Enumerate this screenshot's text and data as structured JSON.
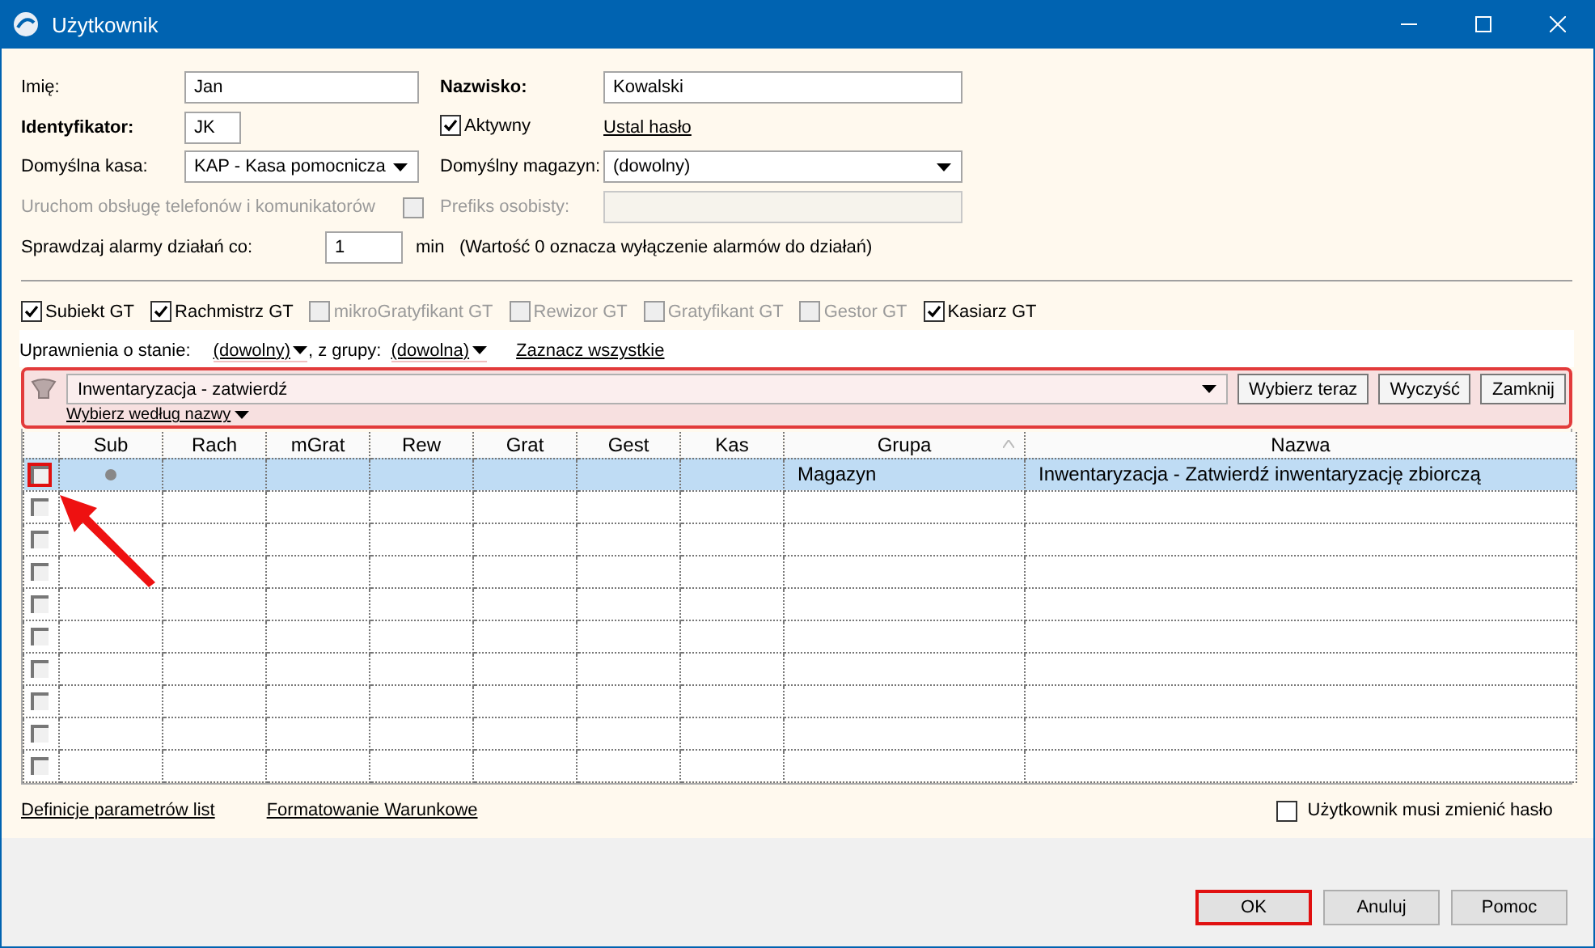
{
  "window": {
    "title": "Użytkownik"
  },
  "form": {
    "first_name": {
      "label": "Imię:",
      "value": "Jan"
    },
    "last_name": {
      "label": "Nazwisko:",
      "value": "Kowalski"
    },
    "identifier": {
      "label": "Identyfikator:",
      "value": "JK"
    },
    "active": {
      "label": "Aktywny",
      "checked": true
    },
    "set_password_link": "Ustal hasło",
    "default_cash": {
      "label": "Domyślna kasa:",
      "value": "KAP - Kasa pomocnicza"
    },
    "default_warehouse": {
      "label": "Domyślny magazyn:",
      "value": "(dowolny)"
    },
    "phone_service": {
      "label": "Uruchom obsługę telefonów i komunikatorów",
      "checked": false,
      "disabled": true
    },
    "personal_prefix": {
      "label": "Prefiks osobisty:",
      "disabled": true
    },
    "alarm_interval": {
      "label": "Sprawdzaj alarmy działań co:",
      "value": "1",
      "unit": "min",
      "note": "(Wartość 0 oznacza wyłączenie alarmów do działań)"
    }
  },
  "modules": [
    {
      "label": "Subiekt GT",
      "checked": true,
      "disabled": false
    },
    {
      "label": "Rachmistrz GT",
      "checked": true,
      "disabled": false
    },
    {
      "label": "mikroGratyfikant GT",
      "checked": false,
      "disabled": true
    },
    {
      "label": "Rewizor GT",
      "checked": false,
      "disabled": true
    },
    {
      "label": "Gratyfikant GT",
      "checked": false,
      "disabled": true
    },
    {
      "label": "Gestor GT",
      "checked": false,
      "disabled": true
    },
    {
      "label": "Kasiarz GT",
      "checked": true,
      "disabled": false
    }
  ],
  "permissions_filter": {
    "state_label": "Uprawnienia o stanie:",
    "state_value": "(dowolny)",
    "group_label": ", z grupy:",
    "group_value": "(dowolna)",
    "select_all": "Zaznacz wszystkie"
  },
  "search_bar": {
    "value": "Inwentaryzacja - zatwierdź",
    "mode": "Wybierz według nazwy",
    "buttons": [
      "Wybierz teraz",
      "Wyczyść",
      "Zamknij"
    ]
  },
  "grid": {
    "columns": [
      "Sub",
      "Rach",
      "mGrat",
      "Rew",
      "Grat",
      "Gest",
      "Kas",
      "Grupa",
      "Nazwa"
    ],
    "rows": [
      {
        "selected": true,
        "checked": false,
        "highlighted": true,
        "sub_marked": true,
        "group": "Magazyn",
        "name": "Inwentaryzacja - Zatwierdź inwentaryzację zbiorczą"
      },
      {
        "selected": false,
        "checked": false,
        "highlighted": false,
        "sub_marked": false
      },
      {
        "selected": false,
        "checked": false,
        "highlighted": false,
        "sub_marked": false
      },
      {
        "selected": false,
        "checked": false,
        "highlighted": false,
        "sub_marked": false
      },
      {
        "selected": false,
        "checked": false,
        "highlighted": false,
        "sub_marked": false
      },
      {
        "selected": false,
        "checked": false,
        "highlighted": false,
        "sub_marked": false
      },
      {
        "selected": false,
        "checked": false,
        "highlighted": false,
        "sub_marked": false
      },
      {
        "selected": false,
        "checked": false,
        "highlighted": false,
        "sub_marked": false
      },
      {
        "selected": false,
        "checked": false,
        "highlighted": false,
        "sub_marked": false
      },
      {
        "selected": false,
        "checked": false,
        "highlighted": false,
        "sub_marked": false
      }
    ]
  },
  "footer": {
    "links": [
      "Definicje parametrów list",
      "Formatowanie Warunkowe"
    ],
    "must_change_password": {
      "label": "Użytkownik musi zmienić hasło",
      "checked": false
    }
  },
  "buttons": [
    {
      "label": "OK",
      "highlighted": true
    },
    {
      "label": "Anuluj",
      "highlighted": false
    },
    {
      "label": "Pomoc",
      "highlighted": false
    }
  ],
  "annotation_arrow": true
}
